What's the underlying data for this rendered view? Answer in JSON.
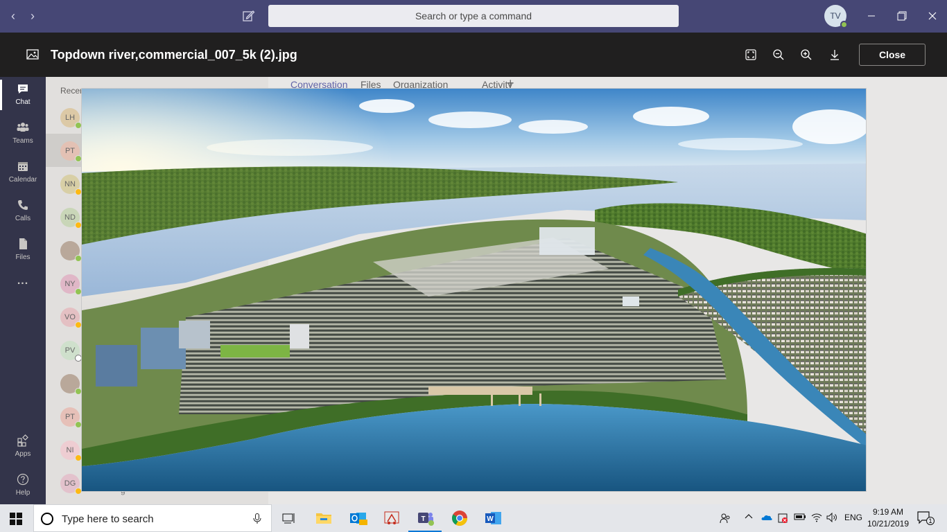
{
  "titlebar": {
    "search_placeholder": "Search or type a command",
    "user_initials": "TV",
    "back_icon": "chevron-left-icon",
    "forward_icon": "chevron-right-icon",
    "compose_icon": "compose-icon",
    "window_controls": [
      "minimize-icon",
      "restore-icon",
      "close-icon"
    ]
  },
  "viewer": {
    "filename": "Topdown river,commercial_007_5k (2).jpg",
    "close_label": "Close",
    "tools": [
      "fit-screen-icon",
      "zoom-out-icon",
      "zoom-in-icon",
      "download-icon"
    ]
  },
  "rail": {
    "items": [
      {
        "label": "Chat",
        "icon": "chat-icon"
      },
      {
        "label": "Teams",
        "icon": "teams-icon"
      },
      {
        "label": "Calendar",
        "icon": "calendar-icon"
      },
      {
        "label": "Calls",
        "icon": "calls-icon"
      },
      {
        "label": "Files",
        "icon": "files-icon"
      },
      {
        "label": "...",
        "icon": "more-icon"
      },
      {
        "label": "Apps",
        "icon": "apps-icon"
      },
      {
        "label": "Help",
        "icon": "help-icon"
      }
    ]
  },
  "chatlist": {
    "recent_label": "Recen",
    "contacts": [
      {
        "initials": "LH",
        "status": "available"
      },
      {
        "initials": "PT",
        "status": "available"
      },
      {
        "initials": "NN",
        "status": "away"
      },
      {
        "initials": "ND",
        "status": "away"
      },
      {
        "initials": "",
        "status": "available"
      },
      {
        "initials": "NY",
        "status": "available"
      },
      {
        "initials": "VO",
        "status": "away"
      },
      {
        "initials": "PV",
        "status": "offline"
      },
      {
        "initials": "",
        "status": "available"
      },
      {
        "initials": "PT",
        "status": "available"
      },
      {
        "initials": "NI",
        "status": "away"
      },
      {
        "initials": "DG",
        "status": "away"
      }
    ],
    "bottom_text": "g"
  },
  "tabs": {
    "conversation": "Conversation",
    "files": "Files",
    "organization": "Organization",
    "activity": "Activity",
    "add_icon": "plus-icon"
  },
  "image": {
    "subject": "aerial-river-city-rendering"
  },
  "taskbar": {
    "search_placeholder": "Type here to search",
    "apps": [
      "task-view-icon",
      "file-explorer-icon",
      "outlook-icon",
      "snipping-icon",
      "teams-icon",
      "chrome-icon",
      "word-icon"
    ],
    "language": "ENG",
    "time": "9:19 AM",
    "date": "10/21/2019",
    "notification_count": "1"
  },
  "colors": {
    "titlebar": "#464775",
    "viewerbar": "#201f1f",
    "rail": "#33344a",
    "accent": "#6264a7",
    "available": "#92c353",
    "away": "#fdb913"
  }
}
